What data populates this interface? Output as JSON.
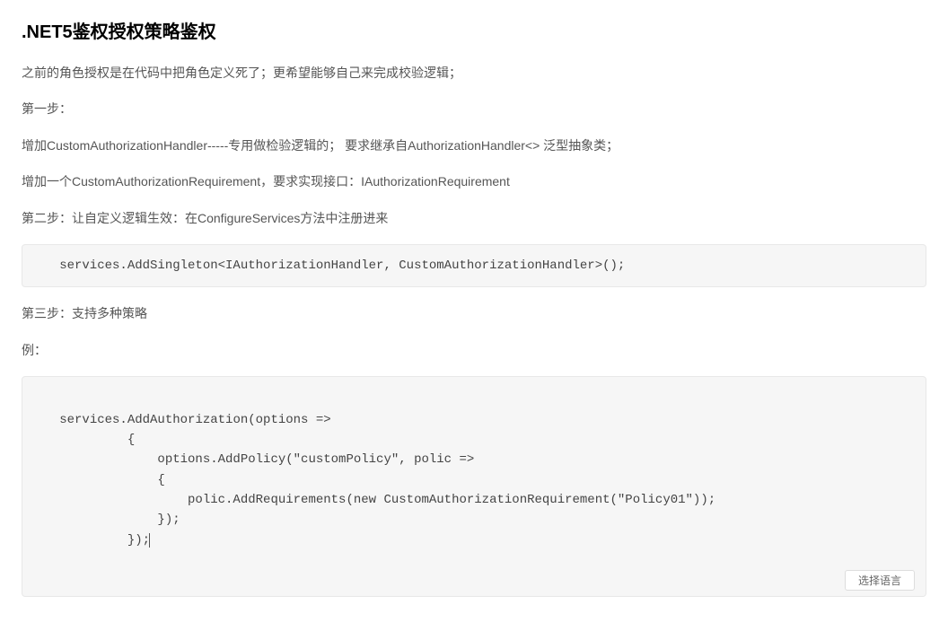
{
  "title": ".NET5鉴权授权策略鉴权",
  "para1": "之前的角色授权是在代码中把角色定义死了；更希望能够自己来完成校验逻辑；",
  "para2": "第一步：",
  "para3": "增加CustomAuthorizationHandler-----专用做检验逻辑的； 要求继承自AuthorizationHandler<> 泛型抽象类；",
  "para4": "增加一个CustomAuthorizationRequirement，要求实现接口：IAuthorizationRequirement",
  "para5": "第二步：让自定义逻辑生效：在ConfigureServices方法中注册进来",
  "code1": "   services.AddSingleton<IAuthorizationHandler, CustomAuthorizationHandler>();",
  "para6": "第三步：支持多种策略",
  "para7": "例：",
  "code2": " services.AddAuthorization(options =>\n            {\n                options.AddPolicy(\"customPolicy\", polic =>\n                {\n                    polic.AddRequirements(new CustomAuthorizationRequirement(\"Policy01\"));\n                });\n            });",
  "langBtn": "选择语言"
}
